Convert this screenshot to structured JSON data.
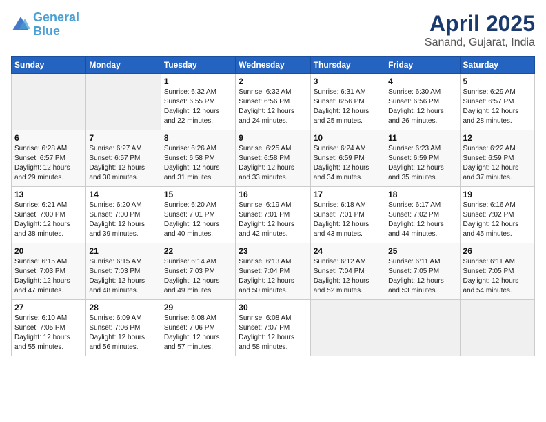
{
  "header": {
    "logo_line1": "General",
    "logo_line2": "Blue",
    "title": "April 2025",
    "subtitle": "Sanand, Gujarat, India"
  },
  "weekdays": [
    "Sunday",
    "Monday",
    "Tuesday",
    "Wednesday",
    "Thursday",
    "Friday",
    "Saturday"
  ],
  "weeks": [
    [
      {
        "day": "",
        "empty": true
      },
      {
        "day": "",
        "empty": true
      },
      {
        "day": "1",
        "sunrise": "6:32 AM",
        "sunset": "6:55 PM",
        "daylight": "12 hours and 22 minutes."
      },
      {
        "day": "2",
        "sunrise": "6:32 AM",
        "sunset": "6:56 PM",
        "daylight": "12 hours and 24 minutes."
      },
      {
        "day": "3",
        "sunrise": "6:31 AM",
        "sunset": "6:56 PM",
        "daylight": "12 hours and 25 minutes."
      },
      {
        "day": "4",
        "sunrise": "6:30 AM",
        "sunset": "6:56 PM",
        "daylight": "12 hours and 26 minutes."
      },
      {
        "day": "5",
        "sunrise": "6:29 AM",
        "sunset": "6:57 PM",
        "daylight": "12 hours and 28 minutes."
      }
    ],
    [
      {
        "day": "6",
        "sunrise": "6:28 AM",
        "sunset": "6:57 PM",
        "daylight": "12 hours and 29 minutes."
      },
      {
        "day": "7",
        "sunrise": "6:27 AM",
        "sunset": "6:57 PM",
        "daylight": "12 hours and 30 minutes."
      },
      {
        "day": "8",
        "sunrise": "6:26 AM",
        "sunset": "6:58 PM",
        "daylight": "12 hours and 31 minutes."
      },
      {
        "day": "9",
        "sunrise": "6:25 AM",
        "sunset": "6:58 PM",
        "daylight": "12 hours and 33 minutes."
      },
      {
        "day": "10",
        "sunrise": "6:24 AM",
        "sunset": "6:59 PM",
        "daylight": "12 hours and 34 minutes."
      },
      {
        "day": "11",
        "sunrise": "6:23 AM",
        "sunset": "6:59 PM",
        "daylight": "12 hours and 35 minutes."
      },
      {
        "day": "12",
        "sunrise": "6:22 AM",
        "sunset": "6:59 PM",
        "daylight": "12 hours and 37 minutes."
      }
    ],
    [
      {
        "day": "13",
        "sunrise": "6:21 AM",
        "sunset": "7:00 PM",
        "daylight": "12 hours and 38 minutes."
      },
      {
        "day": "14",
        "sunrise": "6:20 AM",
        "sunset": "7:00 PM",
        "daylight": "12 hours and 39 minutes."
      },
      {
        "day": "15",
        "sunrise": "6:20 AM",
        "sunset": "7:01 PM",
        "daylight": "12 hours and 40 minutes."
      },
      {
        "day": "16",
        "sunrise": "6:19 AM",
        "sunset": "7:01 PM",
        "daylight": "12 hours and 42 minutes."
      },
      {
        "day": "17",
        "sunrise": "6:18 AM",
        "sunset": "7:01 PM",
        "daylight": "12 hours and 43 minutes."
      },
      {
        "day": "18",
        "sunrise": "6:17 AM",
        "sunset": "7:02 PM",
        "daylight": "12 hours and 44 minutes."
      },
      {
        "day": "19",
        "sunrise": "6:16 AM",
        "sunset": "7:02 PM",
        "daylight": "12 hours and 45 minutes."
      }
    ],
    [
      {
        "day": "20",
        "sunrise": "6:15 AM",
        "sunset": "7:03 PM",
        "daylight": "12 hours and 47 minutes."
      },
      {
        "day": "21",
        "sunrise": "6:15 AM",
        "sunset": "7:03 PM",
        "daylight": "12 hours and 48 minutes."
      },
      {
        "day": "22",
        "sunrise": "6:14 AM",
        "sunset": "7:03 PM",
        "daylight": "12 hours and 49 minutes."
      },
      {
        "day": "23",
        "sunrise": "6:13 AM",
        "sunset": "7:04 PM",
        "daylight": "12 hours and 50 minutes."
      },
      {
        "day": "24",
        "sunrise": "6:12 AM",
        "sunset": "7:04 PM",
        "daylight": "12 hours and 52 minutes."
      },
      {
        "day": "25",
        "sunrise": "6:11 AM",
        "sunset": "7:05 PM",
        "daylight": "12 hours and 53 minutes."
      },
      {
        "day": "26",
        "sunrise": "6:11 AM",
        "sunset": "7:05 PM",
        "daylight": "12 hours and 54 minutes."
      }
    ],
    [
      {
        "day": "27",
        "sunrise": "6:10 AM",
        "sunset": "7:05 PM",
        "daylight": "12 hours and 55 minutes."
      },
      {
        "day": "28",
        "sunrise": "6:09 AM",
        "sunset": "7:06 PM",
        "daylight": "12 hours and 56 minutes."
      },
      {
        "day": "29",
        "sunrise": "6:08 AM",
        "sunset": "7:06 PM",
        "daylight": "12 hours and 57 minutes."
      },
      {
        "day": "30",
        "sunrise": "6:08 AM",
        "sunset": "7:07 PM",
        "daylight": "12 hours and 58 minutes."
      },
      {
        "day": "",
        "empty": true
      },
      {
        "day": "",
        "empty": true
      },
      {
        "day": "",
        "empty": true
      }
    ]
  ]
}
